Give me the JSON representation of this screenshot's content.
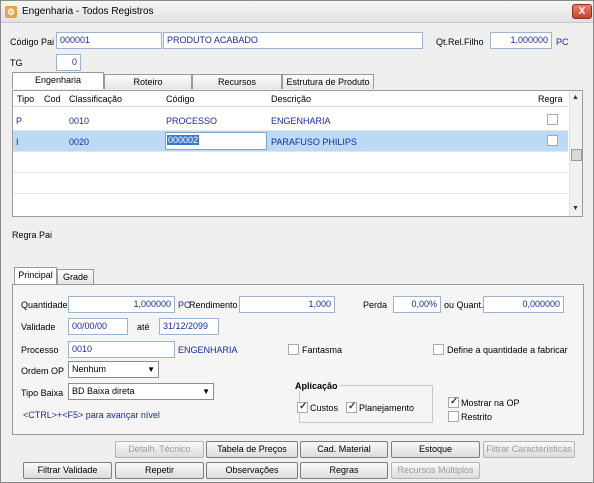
{
  "window": {
    "title": "Engenharia - Todos Registros",
    "close_glyph": "X"
  },
  "header": {
    "codigo_pai_label": "Código Pai",
    "codigo_pai_value": "000001",
    "descricao_value": "PRODUTO ACABADO",
    "qt_rel_filho_label": "Qt.Rel.Filho",
    "qt_rel_filho_value": "1,000000",
    "qt_unit": "PC",
    "tg_label": "TG",
    "tg_value": "0"
  },
  "top_tabs": [
    "Engenharia",
    "Roteiro",
    "Recursos",
    "Estrutura de Produto"
  ],
  "grid": {
    "headers": [
      "Tipo",
      "Cod",
      "Classificação",
      "Código",
      "Descrição",
      "Regra"
    ],
    "rows": [
      {
        "tipo": "P",
        "cod": "",
        "classificacao": "0010",
        "codigo": "PROCESSO",
        "descricao": "ENGENHARIA",
        "regra": false
      },
      {
        "tipo": "I",
        "cod": "",
        "classificacao": "0020",
        "codigo": "000002",
        "descricao": "PARAFUSO PHILIPS",
        "regra": false
      }
    ]
  },
  "regra_pai_label": "Regra Pai",
  "bottom_tabs": [
    "Principal",
    "Grade"
  ],
  "principal": {
    "quantidade_label": "Quantidade",
    "quantidade_value": "1,000000",
    "quantidade_unit": "PC",
    "rendimento_label": "Rendimento",
    "rendimento_value": "1,000",
    "perda_label": "Perda",
    "perda_value": "0,00%",
    "ou_quant_label": "ou Quant.",
    "ou_quant_value": "0,000000",
    "validade_label": "Validade",
    "validade_from": "00/00/00",
    "ate_label": "até",
    "validade_to": "31/12/2099",
    "processo_label": "Processo",
    "processo_value": "0010",
    "processo_desc": "ENGENHARIA",
    "fantasma_label": "Fantasma",
    "define_label": "Define a quantidade a fabricar",
    "ordem_op_label": "Ordem OP",
    "ordem_op_value": "Nenhum",
    "tipo_baixa_label": "Tipo Baixa",
    "tipo_baixa_value": "BD Baixa direta",
    "aplicacao_label": "Aplicação",
    "custos_label": "Custos",
    "planejamento_label": "Planejamento",
    "mostrar_op_label": "Mostrar na OP",
    "restrito_label": "Restrito",
    "hint": "<CTRL>+<F5> para avançar nível"
  },
  "buttons": {
    "detalh_tecnico": "Detalh. Técnico",
    "tabela_precos": "Tabela de Preços",
    "cad_material": "Cad. Material",
    "estoque": "Estoque",
    "filtrar_caracteristicas": "Filtrar Características",
    "filtrar_validade": "Filtrar Validade",
    "repetir": "Repetir",
    "observacoes": "Observações",
    "regras": "Regras",
    "recursos_multiplos": "Recursos Múltiplos"
  }
}
